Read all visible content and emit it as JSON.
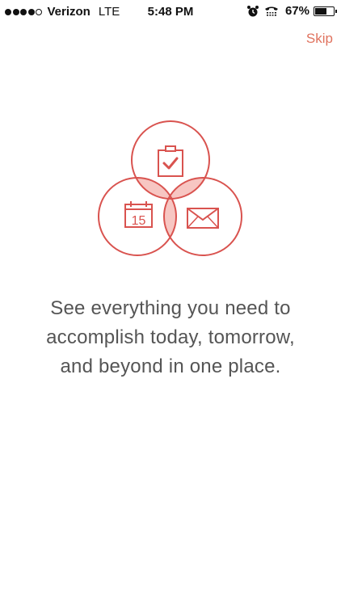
{
  "status_bar": {
    "signal_bars_filled": 4,
    "signal_bars_total": 5,
    "carrier": "Verizon",
    "network": "LTE",
    "time": "5:48 PM",
    "battery_percent_label": "67%",
    "battery_level": 0.67,
    "icons": [
      "alarm-icon",
      "tty-icon",
      "battery-icon"
    ]
  },
  "header": {
    "skip_label": "Skip"
  },
  "illustration": {
    "icons": [
      "clipboard-check-icon",
      "calendar-icon",
      "mail-icon"
    ],
    "calendar_day": "15",
    "accent_color": "#d9534f",
    "overlap_fill": "#f7c6c2"
  },
  "onboarding": {
    "message_lines": [
      "See everything you need to",
      "accomplish today, tomorrow,",
      "and beyond in one place."
    ]
  },
  "colors": {
    "accent": "#e0735f",
    "text": "#555555"
  }
}
